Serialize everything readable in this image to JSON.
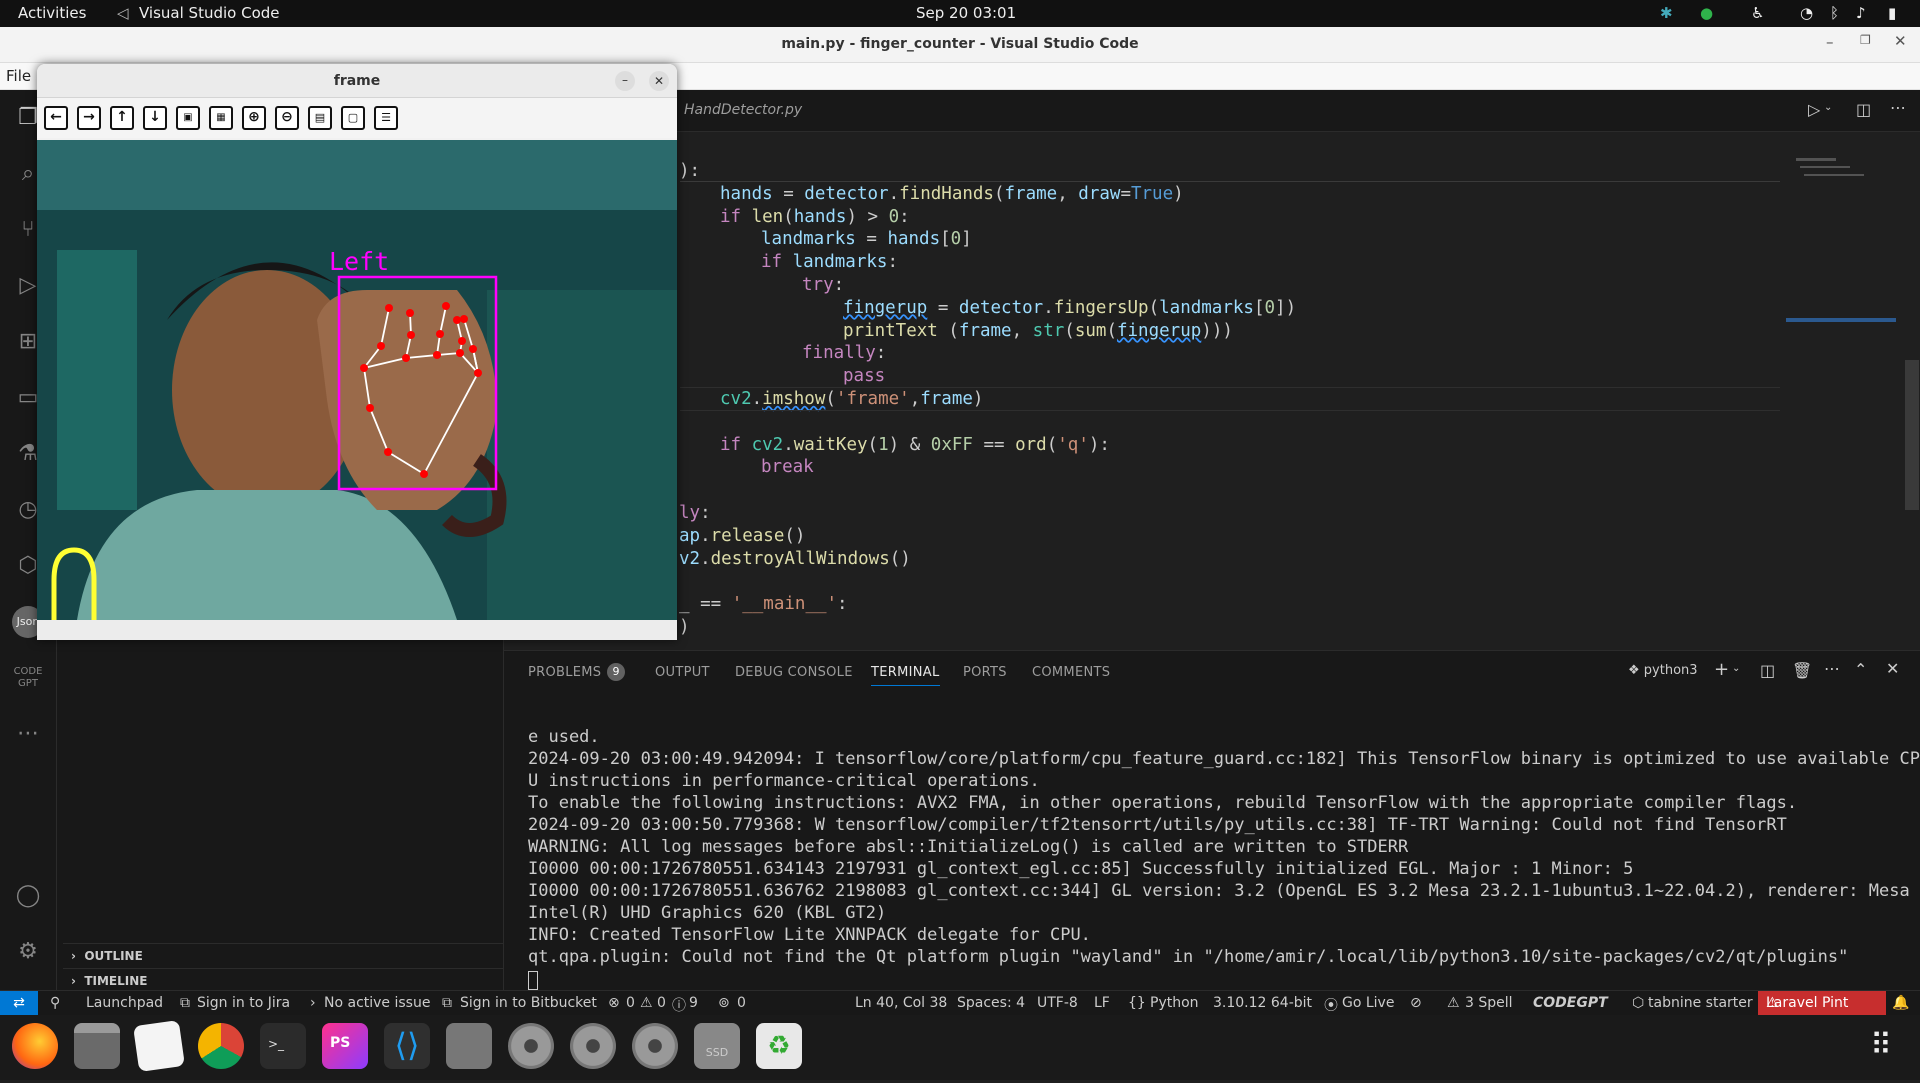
{
  "gnome": {
    "activities": "Activities",
    "app_name": "Visual Studio Code",
    "clock": "Sep 20  03:01"
  },
  "vscode": {
    "window_title": "main.py - finger_counter - Visual Studio Code",
    "menu_file": "File",
    "tab": "HandDetector.py",
    "code_lines": [
      {
        "ind": 0,
        "parts": [
          [
            "n",
            "):"
          ]
        ]
      },
      {
        "ind": 1,
        "parts": [
          [
            "var",
            "hands"
          ],
          [
            "n",
            " = "
          ],
          [
            "var",
            "detector"
          ],
          [
            "n",
            "."
          ],
          [
            "fn",
            "findHands"
          ],
          [
            "n",
            "("
          ],
          [
            "var",
            "frame"
          ],
          [
            "n",
            ", "
          ],
          [
            "var",
            "draw"
          ],
          [
            "n",
            "="
          ],
          [
            "con",
            "True"
          ],
          [
            "n",
            ")"
          ]
        ]
      },
      {
        "ind": 1,
        "parts": [
          [
            "kw",
            "if "
          ],
          [
            "fn",
            "len"
          ],
          [
            "n",
            "("
          ],
          [
            "var",
            "hands"
          ],
          [
            "n",
            ") > "
          ],
          [
            "num",
            "0"
          ],
          [
            "n",
            ":"
          ]
        ]
      },
      {
        "ind": 2,
        "parts": [
          [
            "var",
            "landmarks"
          ],
          [
            "n",
            " = "
          ],
          [
            "var",
            "hands"
          ],
          [
            "n",
            "["
          ],
          [
            "num",
            "0"
          ],
          [
            "n",
            "]"
          ]
        ]
      },
      {
        "ind": 2,
        "parts": [
          [
            "kw",
            "if "
          ],
          [
            "var",
            "landmarks"
          ],
          [
            "n",
            ":"
          ]
        ]
      },
      {
        "ind": 3,
        "parts": [
          [
            "kw",
            "try"
          ],
          [
            "n",
            ":"
          ]
        ]
      },
      {
        "ind": 4,
        "parts": [
          [
            "varsq",
            "fingerup"
          ],
          [
            "n",
            " = "
          ],
          [
            "var",
            "detector"
          ],
          [
            "n",
            "."
          ],
          [
            "fn",
            "fingersUp"
          ],
          [
            "n",
            "("
          ],
          [
            "var",
            "landmarks"
          ],
          [
            "n",
            "["
          ],
          [
            "num",
            "0"
          ],
          [
            "n",
            "])"
          ]
        ]
      },
      {
        "ind": 4,
        "parts": [
          [
            "fn",
            "printText "
          ],
          [
            "n",
            "("
          ],
          [
            "var",
            "frame"
          ],
          [
            "n",
            ", "
          ],
          [
            "bi",
            "str"
          ],
          [
            "n",
            "("
          ],
          [
            "fn",
            "sum"
          ],
          [
            "n",
            "("
          ],
          [
            "varsq",
            "fingerup"
          ],
          [
            "n",
            ")))"
          ]
        ]
      },
      {
        "ind": 3,
        "parts": [
          [
            "kw",
            "finally"
          ],
          [
            "n",
            ":"
          ]
        ]
      },
      {
        "ind": 4,
        "parts": [
          [
            "kw",
            "pass"
          ]
        ]
      },
      {
        "ind": 1,
        "parts": [
          [
            "bi",
            "cv2"
          ],
          [
            "n",
            "."
          ],
          [
            "fnsq",
            "imshow"
          ],
          [
            "n",
            "("
          ],
          [
            "str",
            "'frame'"
          ],
          [
            "n",
            ","
          ],
          [
            "var",
            "frame"
          ],
          [
            "n",
            ")"
          ]
        ]
      },
      {
        "ind": 0,
        "parts": []
      },
      {
        "ind": 1,
        "parts": [
          [
            "kw",
            "if "
          ],
          [
            "bi",
            "cv2"
          ],
          [
            "n",
            "."
          ],
          [
            "fn",
            "waitKey"
          ],
          [
            "n",
            "("
          ],
          [
            "num",
            "1"
          ],
          [
            "n",
            ") & "
          ],
          [
            "num",
            "0xFF"
          ],
          [
            "n",
            " == "
          ],
          [
            "fn",
            "ord"
          ],
          [
            "n",
            "("
          ],
          [
            "str",
            "'q'"
          ],
          [
            "n",
            "):"
          ]
        ]
      },
      {
        "ind": 2,
        "parts": [
          [
            "kw",
            "break"
          ]
        ]
      },
      {
        "ind": 0,
        "parts": []
      },
      {
        "ind": 0,
        "parts": [
          [
            "kw",
            "ly"
          ],
          [
            "n",
            ":"
          ]
        ]
      },
      {
        "ind": 0,
        "parts": [
          [
            "var",
            "ap"
          ],
          [
            "n",
            "."
          ],
          [
            "fn",
            "release"
          ],
          [
            "n",
            "()"
          ]
        ]
      },
      {
        "ind": 0,
        "parts": [
          [
            "var",
            "v2"
          ],
          [
            "n",
            "."
          ],
          [
            "fn",
            "destroyAllWindows"
          ],
          [
            "n",
            "()"
          ]
        ]
      },
      {
        "ind": 0,
        "parts": []
      },
      {
        "ind": 0,
        "parts": [
          [
            "n",
            "_ == "
          ],
          [
            "str",
            "'__main__'"
          ],
          [
            "n",
            ":"
          ]
        ]
      },
      {
        "ind": 0,
        "parts": [
          [
            "n",
            ")"
          ]
        ]
      }
    ]
  },
  "sidebar": {
    "outline": "OUTLINE",
    "timeline": "TIMELINE"
  },
  "panel": {
    "tabs": [
      "PROBLEMS",
      "OUTPUT",
      "DEBUG CONSOLE",
      "TERMINAL",
      "PORTS",
      "COMMENTS"
    ],
    "problems_count": "9",
    "active_tab": "TERMINAL",
    "shell": "python3",
    "terminal_lines": [
      "e used.",
      "2024-09-20 03:00:49.942094: I tensorflow/core/platform/cpu_feature_guard.cc:182] This TensorFlow binary is optimized to use available CP",
      "U instructions in performance-critical operations.",
      "To enable the following instructions: AVX2 FMA, in other operations, rebuild TensorFlow with the appropriate compiler flags.",
      "2024-09-20 03:00:50.779368: W tensorflow/compiler/tf2tensorrt/utils/py_utils.cc:38] TF-TRT Warning: Could not find TensorRT",
      "WARNING: All log messages before absl::InitializeLog() is called are written to STDERR",
      "I0000 00:00:1726780551.634143 2197931 gl_context_egl.cc:85] Successfully initialized EGL. Major : 1 Minor: 5",
      "I0000 00:00:1726780551.636762 2198083 gl_context.cc:344] GL version: 3.2 (OpenGL ES 3.2 Mesa 23.2.1-1ubuntu3.1~22.04.2), renderer: Mesa",
      "Intel(R) UHD Graphics 620 (KBL GT2)",
      "INFO: Created TensorFlow Lite XNNPACK delegate for CPU.",
      "qt.qpa.plugin: Could not find the Qt platform plugin \"wayland\" in \"/home/amir/.local/lib/python3.10/site-packages/cv2/qt/plugins\""
    ]
  },
  "status": {
    "launchpad": "Launchpad",
    "jira": "Sign in to Jira",
    "issue": "No active issue",
    "bitbucket": "Sign in to Bitbucket",
    "errors": "0",
    "warnings": "0",
    "infos": "9",
    "ports": "0",
    "position": "Ln 40, Col 38",
    "spaces": "Spaces: 4",
    "encoding": "UTF-8",
    "eol": "LF",
    "language": "Python",
    "interpreter": "3.10.12 64-bit",
    "golive": "Go Live",
    "spell": "3 Spell",
    "codegpt": "CODEGPT",
    "tabnine": "tabnine starter",
    "laravel": "Laravel Pint"
  },
  "frame_window": {
    "title": "frame",
    "label": "Left"
  },
  "colors": {
    "accent": "#0078d4",
    "laravel_bg": "#c72e2e",
    "hand_box": "#ff00ff",
    "landmark": "#ff0000"
  }
}
